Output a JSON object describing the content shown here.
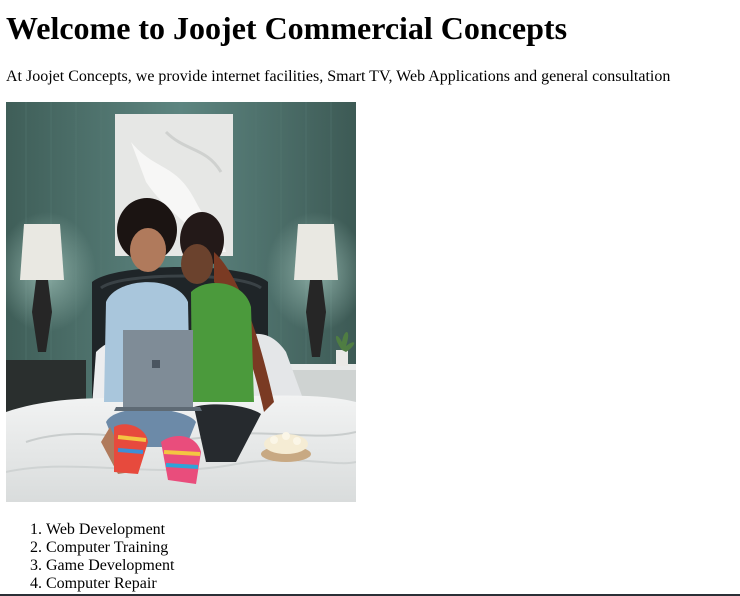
{
  "page": {
    "heading": "Welcome to Joojet Commercial Concepts",
    "intro": "At Joojet Concepts, we provide internet facilities, Smart TV, Web Applications and general consultation"
  },
  "hero_image": {
    "subject": "Two women sitting on a bed looking at a laptop, smiling"
  },
  "services": [
    "Web Development",
    "Computer Training",
    "Game Development",
    "Computer Repair"
  ]
}
